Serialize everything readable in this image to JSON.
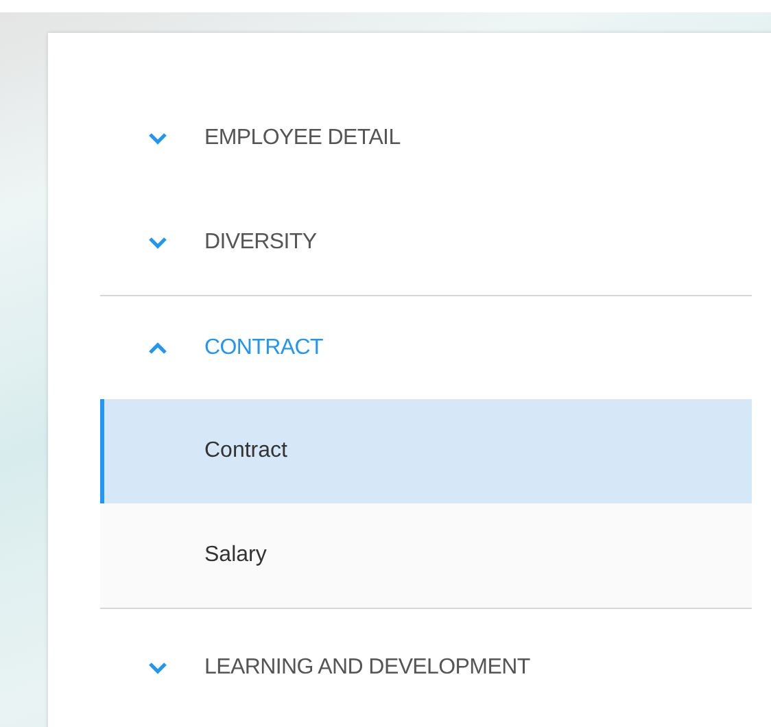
{
  "sections": [
    {
      "label": "EMPLOYEE DETAIL",
      "expanded": false
    },
    {
      "label": "DIVERSITY",
      "expanded": false
    },
    {
      "label": "CONTRACT",
      "expanded": true,
      "children": [
        {
          "label": "Contract",
          "selected": true
        },
        {
          "label": "Salary",
          "selected": false
        }
      ]
    },
    {
      "label": "LEARNING AND DEVELOPMENT",
      "expanded": false
    }
  ]
}
